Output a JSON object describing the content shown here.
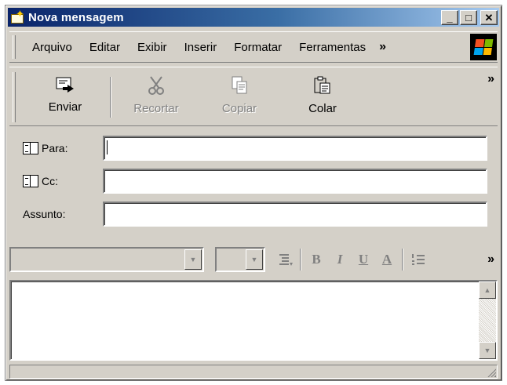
{
  "window": {
    "title": "Nova mensagem",
    "caption": {
      "minimize": "_",
      "maximize": "□",
      "close": "✕"
    }
  },
  "menubar": {
    "items": [
      "Arquivo",
      "Editar",
      "Exibir",
      "Inserir",
      "Formatar",
      "Ferramentas"
    ],
    "overflow": "»"
  },
  "toolbar": {
    "send_label": "Enviar",
    "cut_label": "Recortar",
    "copy_label": "Copiar",
    "paste_label": "Colar",
    "overflow": "»"
  },
  "header_fields": {
    "to_label": "Para:",
    "to_value": "",
    "cc_label": "Cc:",
    "cc_value": "",
    "subject_label": "Assunto:",
    "subject_value": ""
  },
  "formatbar": {
    "font_value": "",
    "size_value": "",
    "bold": "B",
    "italic": "I",
    "underline": "U",
    "font_color": "A",
    "overflow": "»"
  },
  "body": {
    "text": ""
  },
  "colors": {
    "title_gradient_start": "#0a246a",
    "title_gradient_end": "#a6caf0",
    "chrome": "#d4d0c8"
  }
}
